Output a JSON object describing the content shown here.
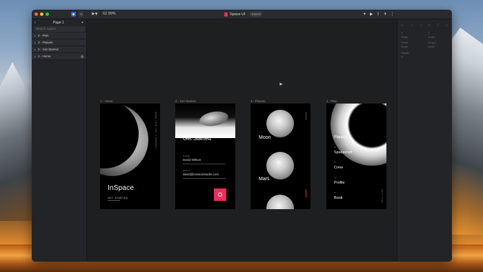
{
  "window": {
    "doc_title": "Space UI",
    "edited_badge": "Edited",
    "zoom": "62.99%"
  },
  "layers_panel": {
    "page_name": "Page 1",
    "search_placeholder": "Search Layers",
    "items": [
      {
        "label": "4 - Plan"
      },
      {
        "label": "3 - Planets"
      },
      {
        "label": "2 - Get Started"
      },
      {
        "label": "1 - Home"
      }
    ]
  },
  "artboards": {
    "home": {
      "label": "1 - Home",
      "title": "InSpace",
      "title_accent": ".",
      "cta": "GET STARTED",
      "vertical": "MORE THAN JUST A JOURNEY"
    },
    "get_started": {
      "label": "2 - Get Started",
      "title": "Get Started",
      "title_accent": ".",
      "name_label": "NAME",
      "name_value": "David Wilson",
      "email_label": "EMAIL",
      "email_value": "david@invisionstudio.com"
    },
    "planets": {
      "label": "3 - Planets",
      "moon": "Moon",
      "mars": "Mars",
      "accent": "."
    },
    "plan": {
      "label": "4 - Plan",
      "items": [
        {
          "num": "01",
          "label": "Planets"
        },
        {
          "num": "02",
          "label": "Spacecraft"
        },
        {
          "num": "03",
          "label": "Crew"
        },
        {
          "num": "04",
          "label": "Profile"
        },
        {
          "num": "05",
          "label": "Book"
        }
      ],
      "side_text": "NEXT STEP"
    }
  },
  "inspector": {
    "x_label": "X",
    "x_val": "Scale",
    "y_label": "Y",
    "y_val": "Scale",
    "w_label": "Width",
    "w_val": "Scale",
    "h_label": "Height",
    "h_val": "Scale",
    "r_label": "Rotate",
    "r_val": "0°"
  },
  "colors": {
    "accent": "#ea2d5c"
  }
}
